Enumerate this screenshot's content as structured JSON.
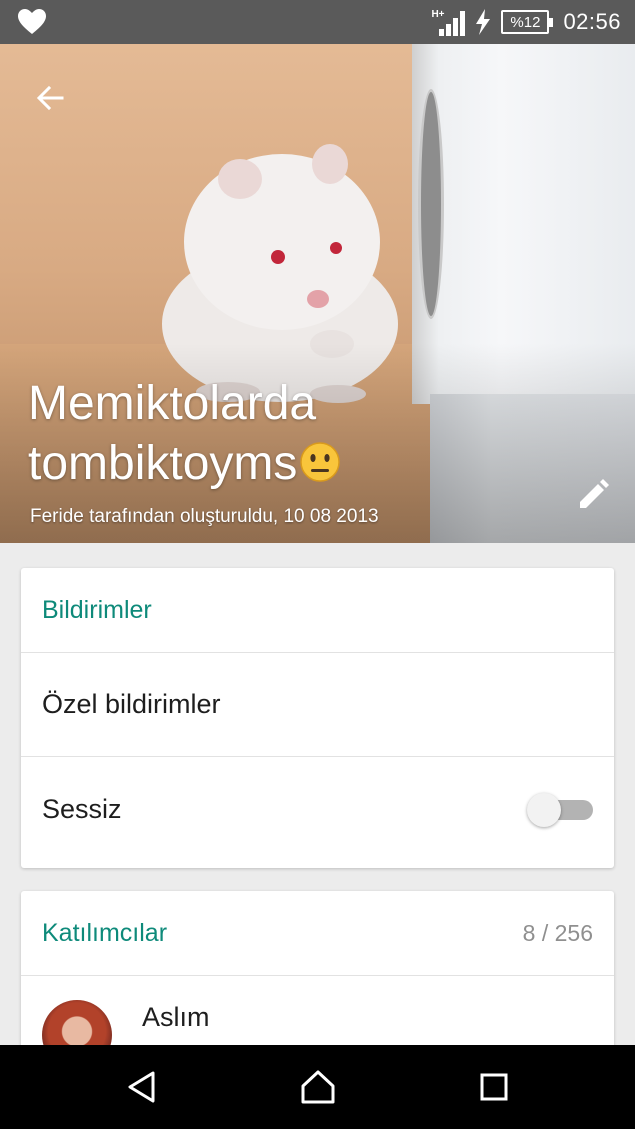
{
  "status_bar": {
    "network": "H+",
    "battery": "%12",
    "time": "02:56",
    "icons": [
      "heart-icon",
      "signal-icon",
      "charging-bolt-icon",
      "battery-icon"
    ]
  },
  "group": {
    "name": "Memiktolarda tombiktoyms",
    "emoji": "neutral-face-emoji",
    "created_by": "Feride tarafından oluşturuldu, 10 08 2013"
  },
  "notifications": {
    "heading": "Bildirimler",
    "custom_label": "Özel bildirimler",
    "mute_label": "Sessiz",
    "mute_on": false
  },
  "participants": {
    "heading": "Katılımcılar",
    "count": "8 / 256",
    "members": [
      {
        "name": "Aslım"
      }
    ]
  },
  "nav": {
    "icons": [
      "back-triangle-icon",
      "home-icon",
      "recents-square-icon"
    ]
  },
  "colors": {
    "accent": "#0e8a7a",
    "status_bar": "#5a5a5a",
    "nav_bar": "#000000"
  }
}
